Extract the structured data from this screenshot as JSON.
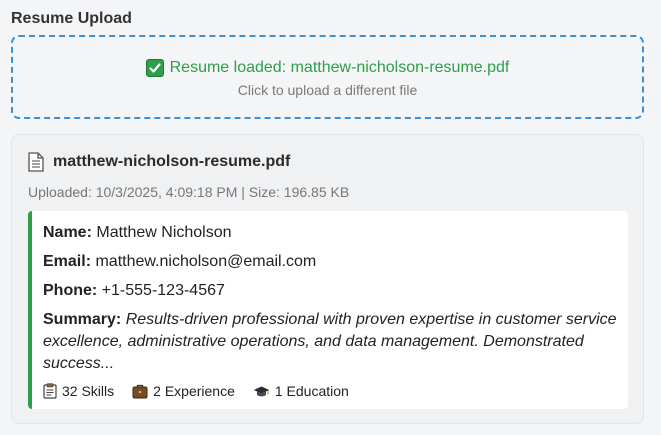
{
  "section": {
    "title": "Resume Upload"
  },
  "dropzone": {
    "status": "Resume loaded: matthew-nicholson-resume.pdf",
    "hint": "Click to upload a different file",
    "status_color": "#2e9e4b",
    "border_color": "#3b8fd4"
  },
  "file": {
    "name": "matthew-nicholson-resume.pdf",
    "meta": "Uploaded: 10/3/2025, 4:09:18 PM | Size: 196.85 KB",
    "icon": "document-icon"
  },
  "details": {
    "name_label": "Name:",
    "name_value": "Matthew Nicholson",
    "email_label": "Email:",
    "email_value": "matthew.nicholson@email.com",
    "phone_label": "Phone:",
    "phone_value": "+1-555-123-4567",
    "summary_label": "Summary:",
    "summary_value": "Results-driven professional with proven expertise in customer service excellence, administrative operations, and data management. Demonstrated success...",
    "accent_color": "#2e9e4b"
  },
  "counts": [
    {
      "icon": "clipboard-icon",
      "text": "32 Skills"
    },
    {
      "icon": "briefcase-icon",
      "text": "2 Experience"
    },
    {
      "icon": "graduation-cap-icon",
      "text": "1 Education"
    }
  ]
}
